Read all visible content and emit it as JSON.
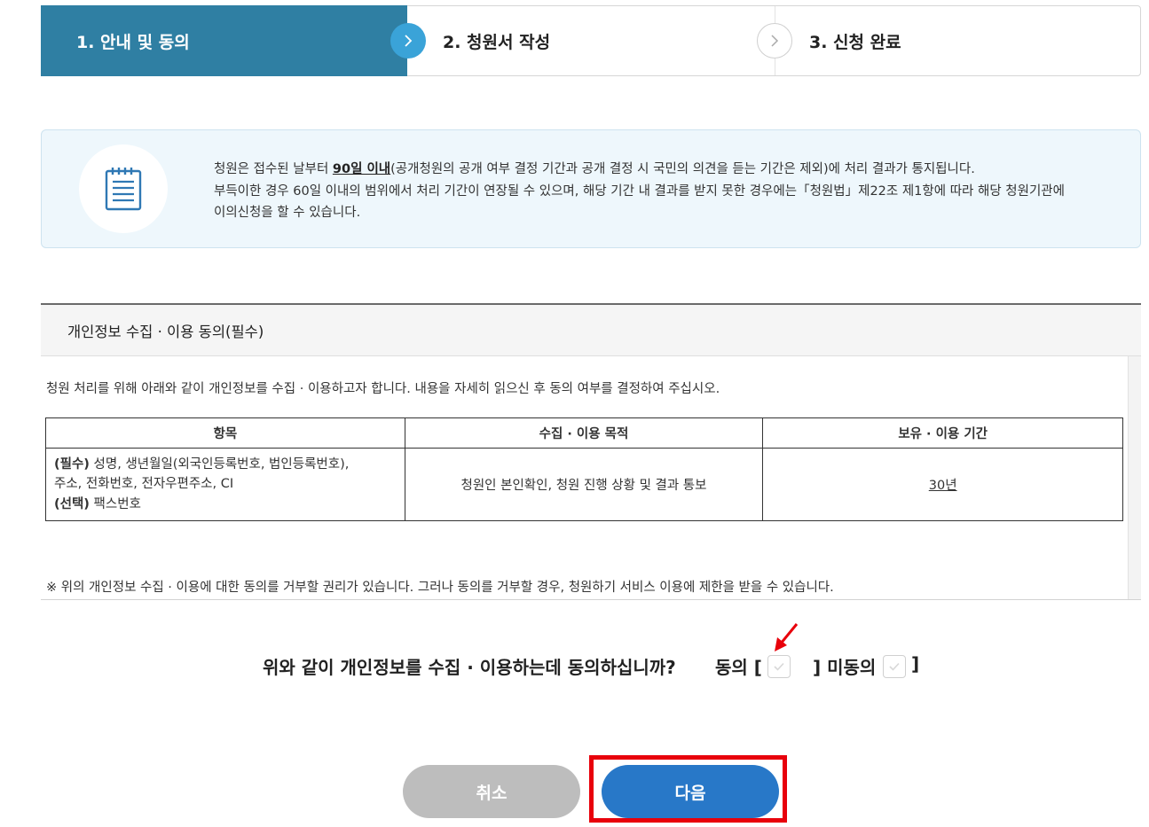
{
  "stepper": {
    "steps": [
      {
        "label": "1. 안내 및 동의",
        "active": true
      },
      {
        "label": "2. 청원서 작성",
        "active": false
      },
      {
        "label": "3. 신청 완료",
        "active": false
      }
    ]
  },
  "info": {
    "icon": "document-list-icon",
    "line1_before": "청원은 접수된 날부터 ",
    "line1_emph": "90일 이내",
    "line1_after": "(공개청원의 공개 여부 결정 기간과 공개 결정 시 국민의 의견을 듣는 기간은 제외)에 처리 결과가 통지됩니다.",
    "line2": "부득이한 경우 60일 이내의 범위에서 처리 기간이 연장될 수 있으며, 해당 기간 내 결과를 받지 못한 경우에는「청원법」제22조 제1항에 따라 해당 청원기관에",
    "line3": "이의신청을 할 수 있습니다."
  },
  "consent": {
    "title": "개인정보 수집 · 이용 동의(필수)",
    "intro": "청원 처리를 위해 아래와 같이 개인정보를 수집 · 이용하고자 합니다. 내용을 자세히 읽으신 후 동의 여부를 결정하여 주십시오.",
    "table": {
      "headers": [
        "항목",
        "수집 · 이용 목적",
        "보유 · 이용 기간"
      ],
      "row": {
        "required_tag": "(필수)",
        "required_items_1": " 성명, 생년월일(외국인등록번호, 법인등록번호),",
        "required_items_2": "주소, 전화번호, 전자우편주소, CI",
        "optional_tag": "(선택)",
        "optional_items": " 팩스번호",
        "purpose": "청원인 본인확인, 청원 진행 상황 및 결과 통보",
        "period": "30년"
      }
    },
    "note": "※ 위의 개인정보 수집 · 이용에 대한 동의를 거부할 권리가 있습니다. 그러나 동의를 거부할 경우, 청원하기 서비스 이용에 제한을 받을 수 있습니다."
  },
  "question": {
    "text": "위와 같이 개인정보를 수집 · 이용하는데 동의하십니까?",
    "agree_label": "동의 [",
    "disagree_label": "]  미동의 [",
    "close_bracket": "]"
  },
  "buttons": {
    "cancel": "취소",
    "next": "다음"
  },
  "colors": {
    "step_active": "#2f7fa3",
    "step_circle": "#3aa3d8",
    "next_button": "#2878c8",
    "cancel_button": "#bdbdbd",
    "highlight": "#e8000b"
  }
}
